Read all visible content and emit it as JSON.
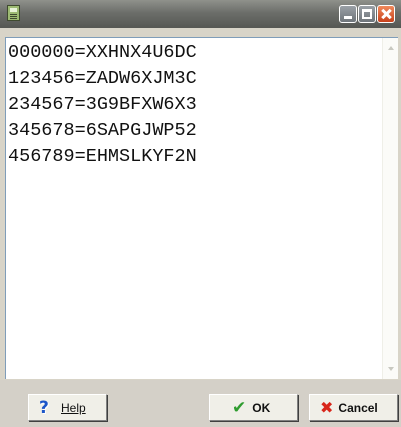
{
  "window": {
    "title": "",
    "icons": {
      "app": "app-icon",
      "minimize": "minimize-icon",
      "maximize": "maximize-icon",
      "close": "close-icon"
    }
  },
  "textarea": {
    "lines": [
      "000000=XXHNX4U6DC",
      "123456=ZADW6XJM3C",
      "234567=3G9BFXW6X3",
      "345678=6SAPGJWP52",
      "456789=EHMSLKYF2N"
    ]
  },
  "buttons": {
    "help": {
      "label": "Help",
      "icon": "help-icon"
    },
    "ok": {
      "label": "OK",
      "icon": "checkmark-icon"
    },
    "cancel": {
      "label": "Cancel",
      "icon": "x-icon"
    }
  },
  "colors": {
    "title_bar": "#6c6e6a",
    "close_button": "#c8411b",
    "ok_check": "#2f9c2f",
    "cancel_x": "#d8261a",
    "help_icon": "#1d56c8"
  }
}
